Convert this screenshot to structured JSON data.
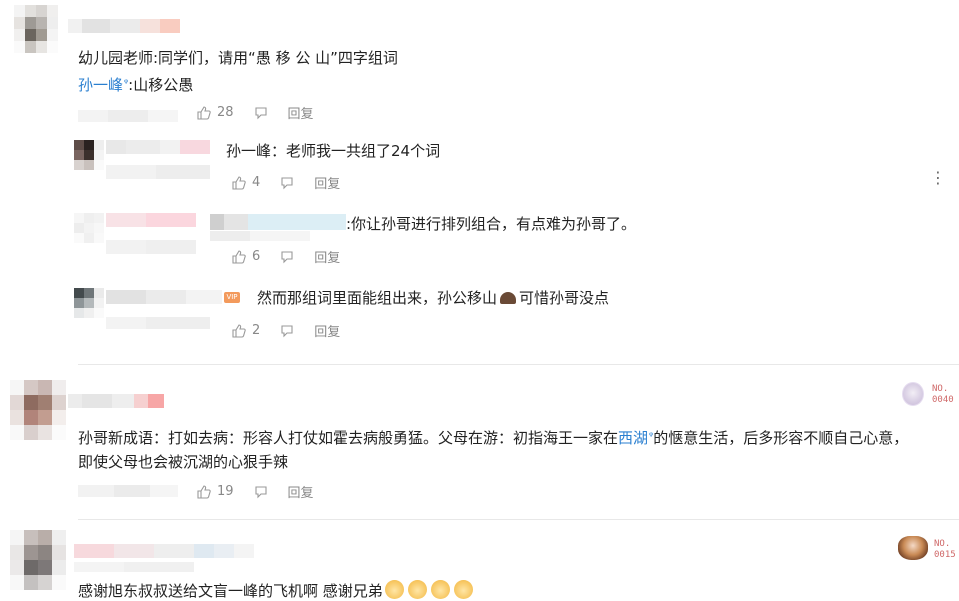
{
  "comments": [
    {
      "text_prefix": "幼儿园老师:同学们，请用“愚 移 公 山”四字组词",
      "reply_user": "孙一峰",
      "reply_text": ":山移公愚",
      "likes": "28",
      "reply_label": "回复",
      "replies": [
        {
          "text": "孙一峰：老师我一共组了24个词",
          "likes": "4",
          "reply_label": "回复"
        },
        {
          "text": ":你让孙哥进行排列组合，有点难为孙哥了。",
          "likes": "6",
          "reply_label": "回复"
        },
        {
          "text_before": "然而那组词里面能组出来，孙公移山",
          "text_after": "可惜孙哥没点",
          "likes": "2",
          "reply_label": "回复",
          "vip_label": "VIP"
        }
      ]
    },
    {
      "line1_before": "孙哥新成语：打如去病：形容人打仗如霍去病般勇猛。父母在游：初指海王一家在",
      "line1_link": "西湖",
      "line1_after": "的惬意生活，后多形容不顺自己心意，",
      "line2": "即使父母也会被沉湖的心狠手辣",
      "likes": "19",
      "reply_label": "回复",
      "badge_line1": "NO.",
      "badge_line2": "0040"
    },
    {
      "text": "感谢旭东叔叔送给文盲一峰的飞机啊 感谢兄弟",
      "badge_line1": "NO.",
      "badge_line2": "0015"
    }
  ],
  "icons": {
    "search_mark": "ᵠ",
    "more": "⋮",
    "emoji_poop": "💩",
    "emoji_cat": "😸"
  }
}
